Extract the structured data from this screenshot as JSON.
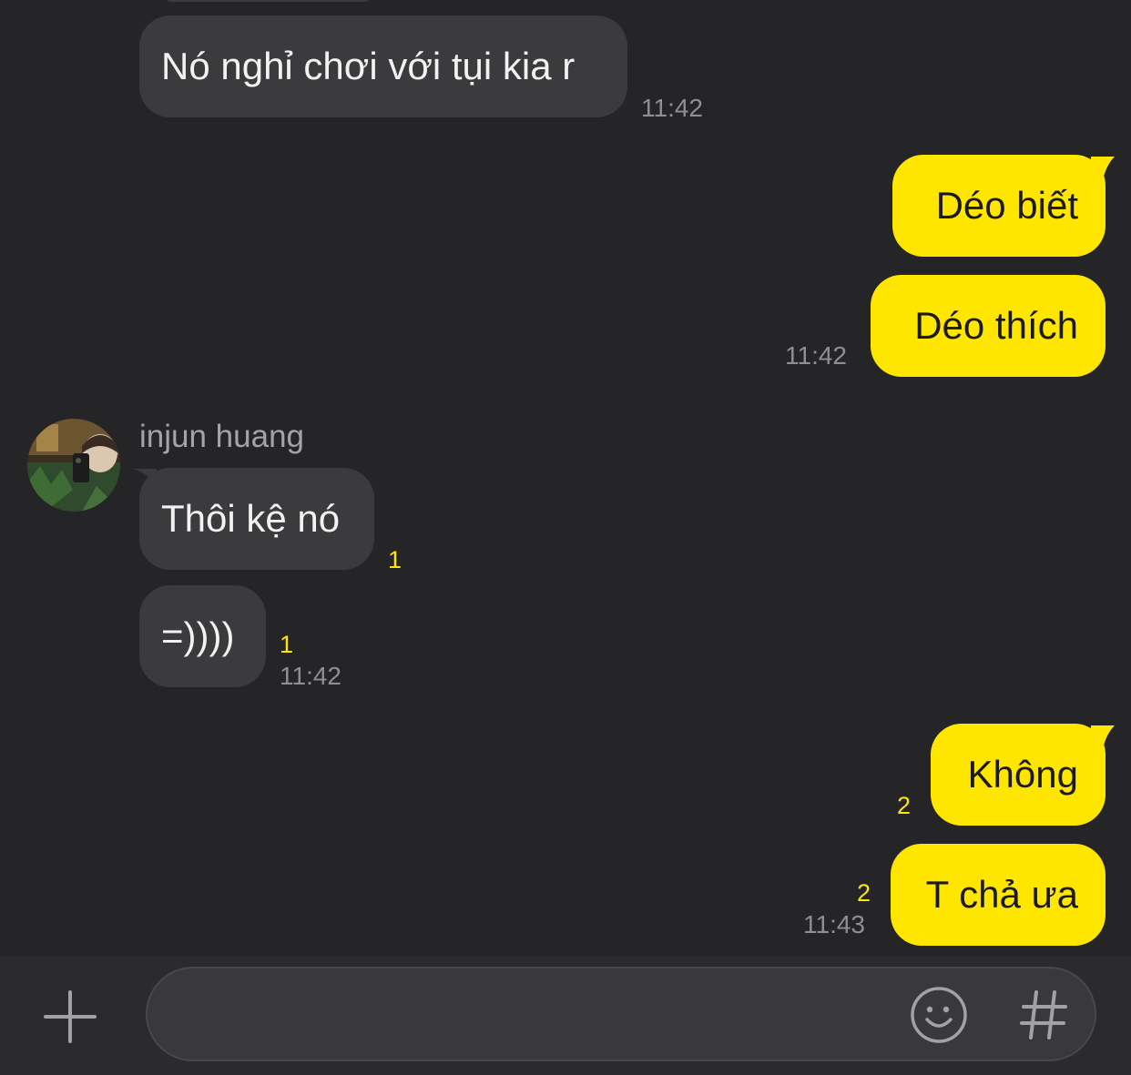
{
  "conversation": {
    "contact": {
      "name": "injun huang"
    },
    "messages": [
      {
        "direction": "incoming",
        "text": "Nó nghỉ chơi với tụi kia r",
        "time": "11:42"
      },
      {
        "direction": "outgoing",
        "text": "Déo biết"
      },
      {
        "direction": "outgoing",
        "text": "Déo thích",
        "time": "11:42"
      },
      {
        "direction": "incoming",
        "text": "Thôi kệ nó",
        "unread": "1"
      },
      {
        "direction": "incoming",
        "text": "=))))",
        "unread": "1",
        "time": "11:42"
      },
      {
        "direction": "outgoing",
        "text": "Không",
        "unread": "2"
      },
      {
        "direction": "outgoing",
        "text": "T chả ưa",
        "unread": "2",
        "time": "11:43"
      }
    ]
  },
  "composer": {
    "input_value": "",
    "input_placeholder": "",
    "plus_icon": "plus-icon",
    "emoji_icon": "smiley-icon",
    "hash_icon": "hashtag-icon"
  },
  "colors": {
    "background": "#252527",
    "incoming_bubble": "#3b3b3e",
    "outgoing_bubble": "#ffe600",
    "unread_count": "#ffe600",
    "timestamp": "#8e8e93",
    "input_bar": "#2b2b2d"
  }
}
